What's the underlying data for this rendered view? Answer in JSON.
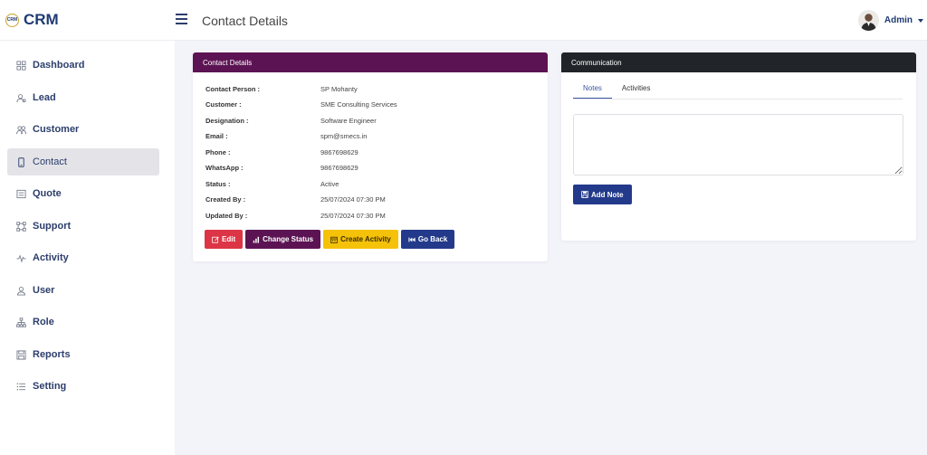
{
  "app": {
    "logo_mark": "CRM",
    "logo_text": "CRM",
    "page_title": "Contact Details"
  },
  "user": {
    "name": "Admin"
  },
  "sidebar": {
    "items": [
      {
        "label": "Dashboard",
        "icon": "dashboard-icon"
      },
      {
        "label": "Lead",
        "icon": "users-icon"
      },
      {
        "label": "Customer",
        "icon": "group-icon"
      },
      {
        "label": "Contact",
        "icon": "phone-icon",
        "active": true
      },
      {
        "label": "Quote",
        "icon": "list-icon"
      },
      {
        "label": "Support",
        "icon": "nodes-icon"
      },
      {
        "label": "Activity",
        "icon": "pulse-icon"
      },
      {
        "label": "User",
        "icon": "user-icon"
      },
      {
        "label": "Role",
        "icon": "hierarchy-icon"
      },
      {
        "label": "Reports",
        "icon": "report-icon"
      },
      {
        "label": "Setting",
        "icon": "settings-list-icon"
      }
    ]
  },
  "contact_card": {
    "title": "Contact Details",
    "rows": [
      {
        "label": "Contact Person :",
        "value": "SP Mohanty"
      },
      {
        "label": "Customer :",
        "value": "SME Consulting Services"
      },
      {
        "label": "Designation :",
        "value": "Software Engineer"
      },
      {
        "label": "Email :",
        "value": "spm@smecs.in"
      },
      {
        "label": "Phone :",
        "value": "9867698629"
      },
      {
        "label": "WhatsApp :",
        "value": "9867698629"
      },
      {
        "label": "Status :",
        "value": "Active"
      },
      {
        "label": "Created By :",
        "value": "25/07/2024 07:30 PM"
      },
      {
        "label": "Updated By :",
        "value": "25/07/2024 07:30 PM"
      }
    ],
    "buttons": {
      "edit": "Edit",
      "change_status": "Change Status",
      "create_activity": "Create Activity",
      "go_back": "Go Back"
    }
  },
  "communication": {
    "title": "Communication",
    "tabs": [
      "Notes",
      "Activities"
    ],
    "add_note": "Add Note"
  },
  "colors": {
    "brand": "#1f3b73",
    "contact_header": "#5c1353",
    "communication_header": "#212529",
    "edit": "#dc3545",
    "activity": "#f5c20a",
    "primary": "#233a8b"
  }
}
